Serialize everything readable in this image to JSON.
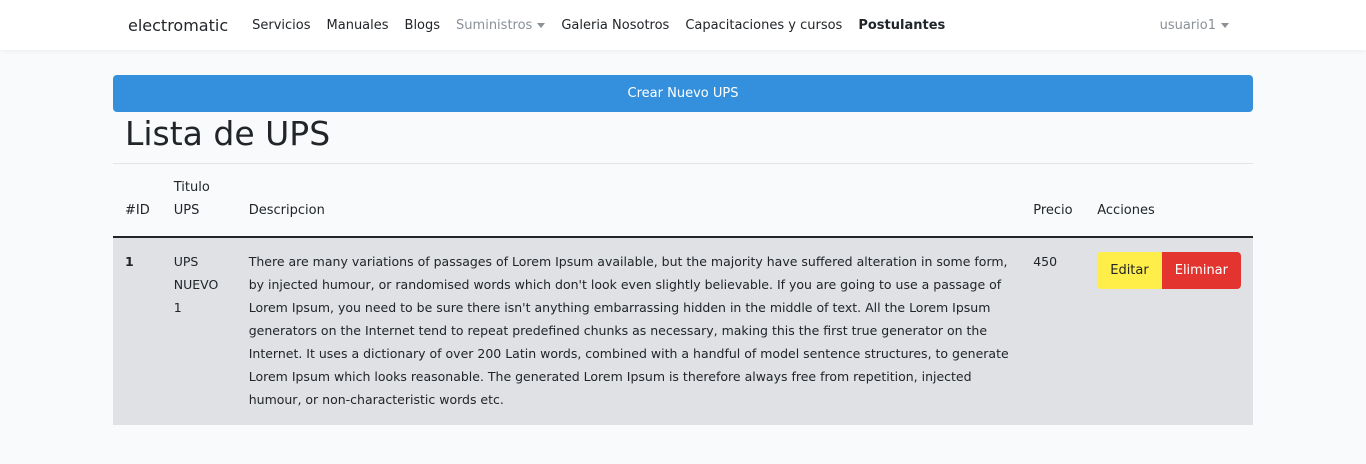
{
  "navbar": {
    "brand": "electromatic",
    "links": [
      {
        "label": "Servicios"
      },
      {
        "label": "Manuales"
      },
      {
        "label": "Blogs"
      },
      {
        "label": "Suministros"
      },
      {
        "label": "Galeria Nosotros"
      },
      {
        "label": "Capacitaciones y cursos"
      },
      {
        "label": "Postulantes"
      }
    ],
    "user": "usuario1"
  },
  "main": {
    "create_button": "Crear Nuevo UPS",
    "title": "Lista de UPS",
    "table": {
      "headers": [
        "#ID",
        "Titulo UPS",
        "Descripcion",
        "Precio",
        "Acciones"
      ],
      "rows": [
        {
          "id": "1",
          "title": "UPS NUEVO 1",
          "description": "There are many variations of passages of Lorem Ipsum available, but the majority have suffered alteration in some form, by injected humour, or randomised words which don't look even slightly believable. If you are going to use a passage of Lorem Ipsum, you need to be sure there isn't anything embarrassing hidden in the middle of text. All the Lorem Ipsum generators on the Internet tend to repeat predefined chunks as necessary, making this the first true generator on the Internet. It uses a dictionary of over 200 Latin words, combined with a handful of model sentence structures, to generate Lorem Ipsum which looks reasonable. The generated Lorem Ipsum is therefore always free from repetition, injected humour, or non-characteristic words etc.",
          "price": "450",
          "edit_label": "Editar",
          "delete_label": "Eliminar"
        }
      ]
    }
  },
  "colors": {
    "primary": "#3490dc",
    "warning": "#ffed4a",
    "danger": "#e3342f",
    "row_bg": "#dfe1e4"
  },
  "icons": {
    "dropdown": "caret-down-icon"
  }
}
